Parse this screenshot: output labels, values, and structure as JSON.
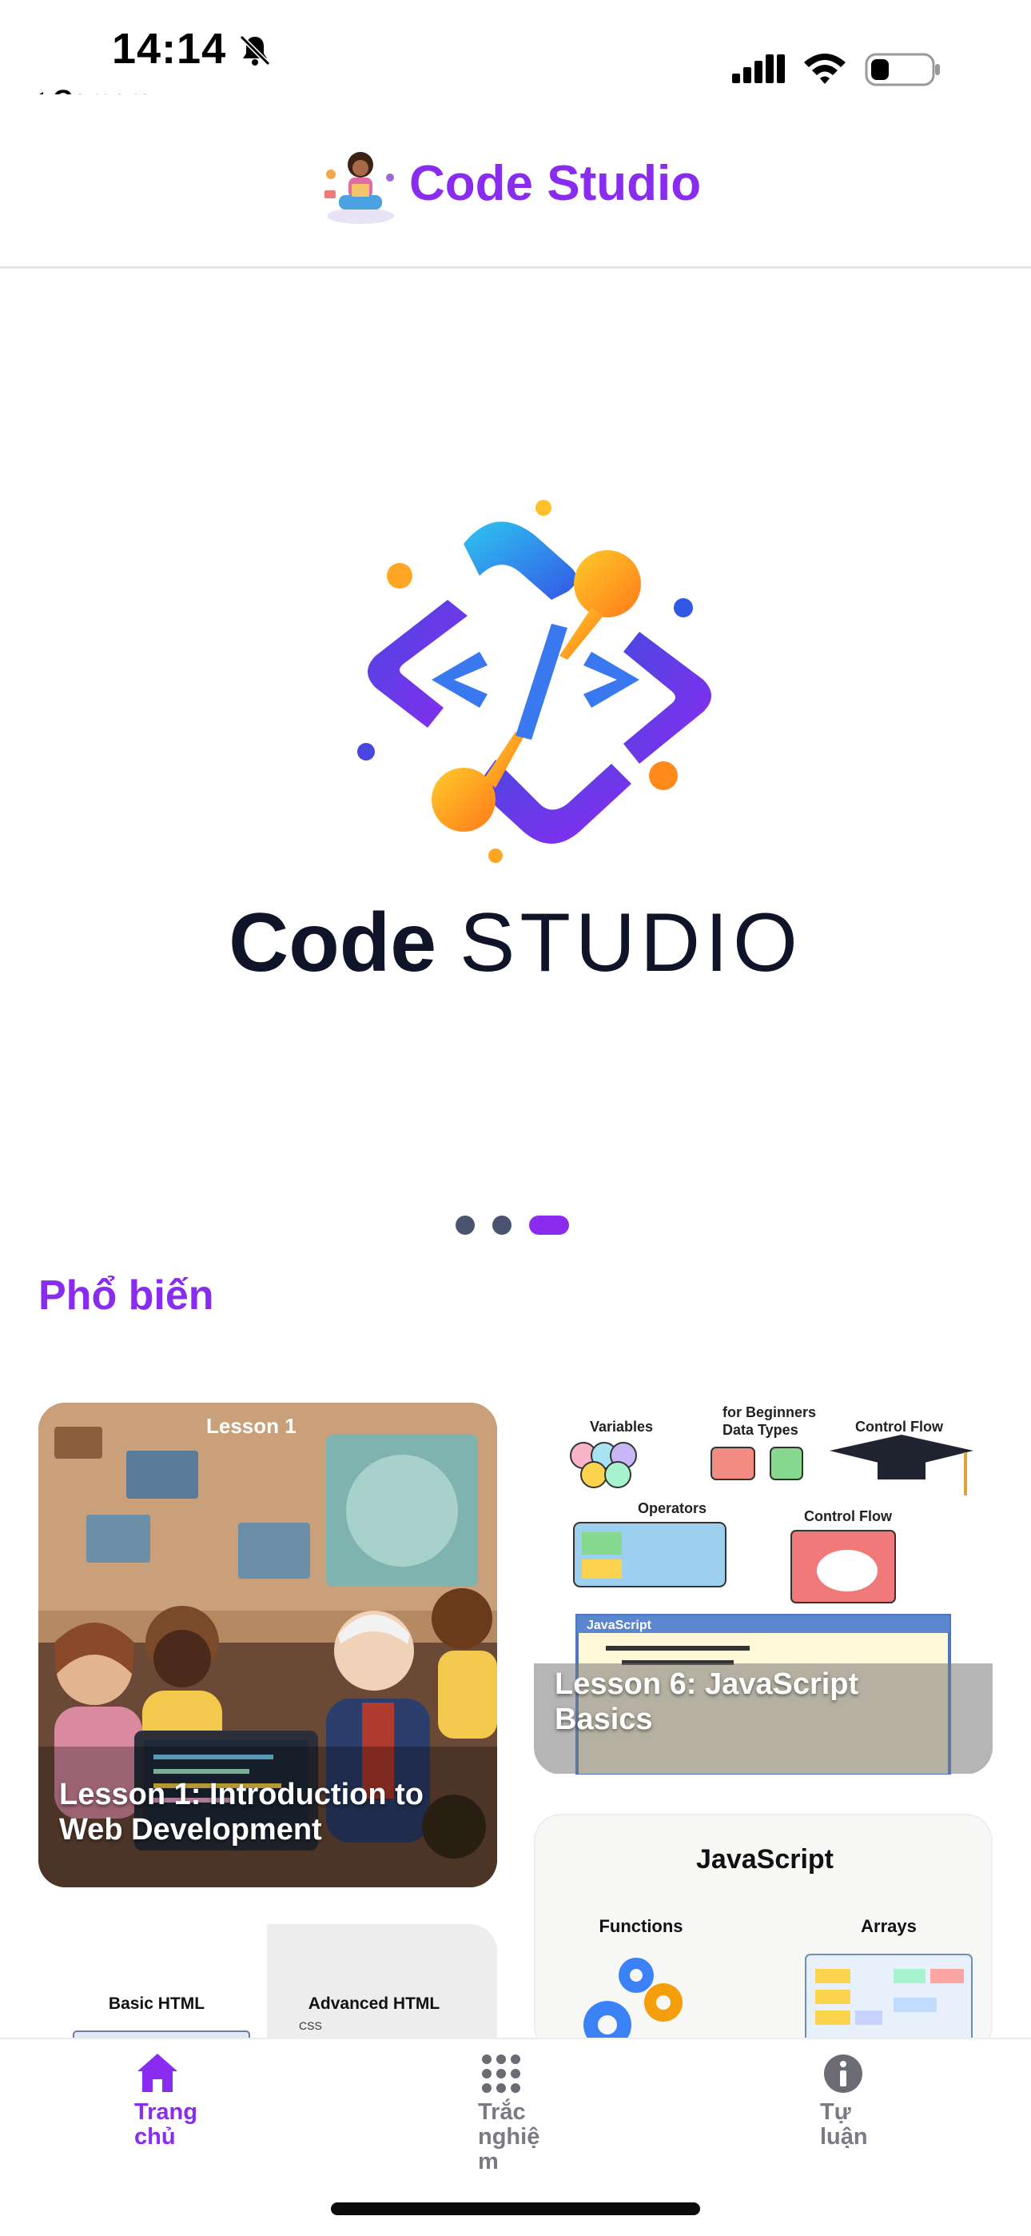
{
  "status_bar": {
    "time": "14:14",
    "back_app": "Camera"
  },
  "header": {
    "title": "Code Studio"
  },
  "hero": {
    "wordmark_bold": "Code",
    "wordmark_light": "STUDIO",
    "slide_count": 3,
    "active_slide": 3
  },
  "section": {
    "title": "Phổ biến"
  },
  "cards": [
    {
      "badge": "Lesson 1",
      "title": "Lesson 1: Introduction to Web Development"
    },
    {
      "title": "Lesson 6: JavaScript Basics",
      "labels": [
        "Variables",
        "for Beginners",
        "Data Types",
        "Control Flow",
        "Operators",
        "Control Flow",
        "JavaScript"
      ]
    },
    {
      "heading": "JavaScript",
      "left_label": "Functions",
      "right_label": "Arrays"
    },
    {
      "left_label": "Basic HTML",
      "right_label": "Advanced HTML",
      "sub_label": "CSS"
    }
  ],
  "tabs": [
    {
      "label": "Trang chủ",
      "icon": "home-icon",
      "active": true
    },
    {
      "label": "Trắc nghiệm",
      "icon": "grid-icon",
      "active": false
    },
    {
      "label": "Tự luận",
      "icon": "info-icon",
      "active": false
    }
  ],
  "colors": {
    "accent": "#8a2cf0",
    "dot_inactive": "#4a5470",
    "wordmark": "#0f1428"
  }
}
